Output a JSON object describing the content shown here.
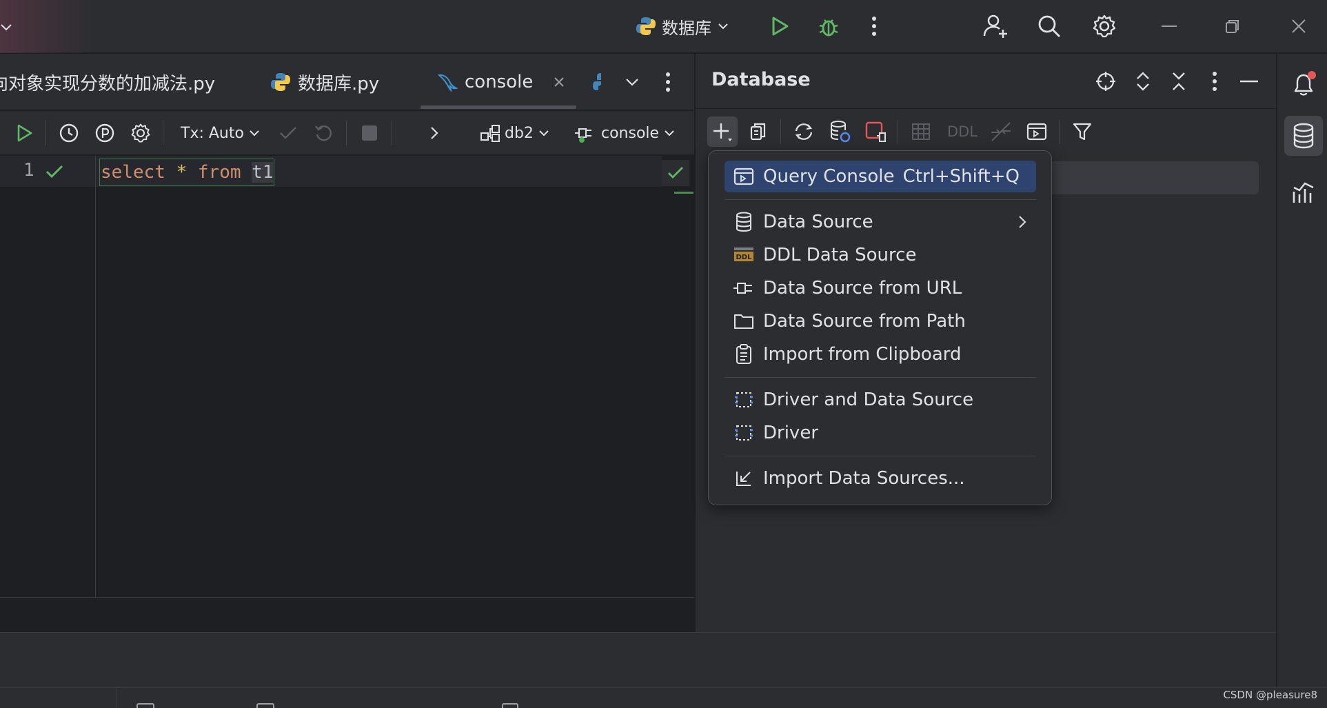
{
  "titlebar": {
    "run_config_label": "数据库"
  },
  "tabs": [
    {
      "label": "向对象实现分数的加减法.py"
    },
    {
      "label": "数据库.py"
    },
    {
      "label": "console"
    }
  ],
  "editor_toolbar": {
    "tx_label": "Tx: Auto",
    "schema_label": "db2",
    "session_label": "console"
  },
  "editor": {
    "line_number": "1",
    "code": {
      "kw1": "select",
      "star": "*",
      "kw2": "from",
      "ident": "t1"
    }
  },
  "database_panel": {
    "title": "Database",
    "ddl_button_label": "DDL"
  },
  "popup_menu": {
    "items": [
      {
        "label": "Query Console",
        "shortcut": "Ctrl+Shift+Q",
        "icon": "query-console-icon"
      },
      {
        "label": "Data Source",
        "icon": "database-icon"
      },
      {
        "label": "DDL Data Source",
        "icon": "ddl-icon"
      },
      {
        "label": "Data Source from URL",
        "icon": "plug-icon"
      },
      {
        "label": "Data Source from Path",
        "icon": "folder-icon"
      },
      {
        "label": "Import from Clipboard",
        "icon": "clipboard-icon"
      },
      {
        "label": "Driver and Data Source",
        "icon": "driver-icon"
      },
      {
        "label": "Driver",
        "icon": "driver-icon"
      },
      {
        "label": "Import Data Sources...",
        "icon": "import-icon"
      }
    ]
  },
  "colors": {
    "accent_selection": "#2e436e",
    "run_green": "#5fb865",
    "keyword_orange": "#cf8e6d",
    "notification_red": "#e55757"
  },
  "watermark": "CSDN @pleasure8"
}
